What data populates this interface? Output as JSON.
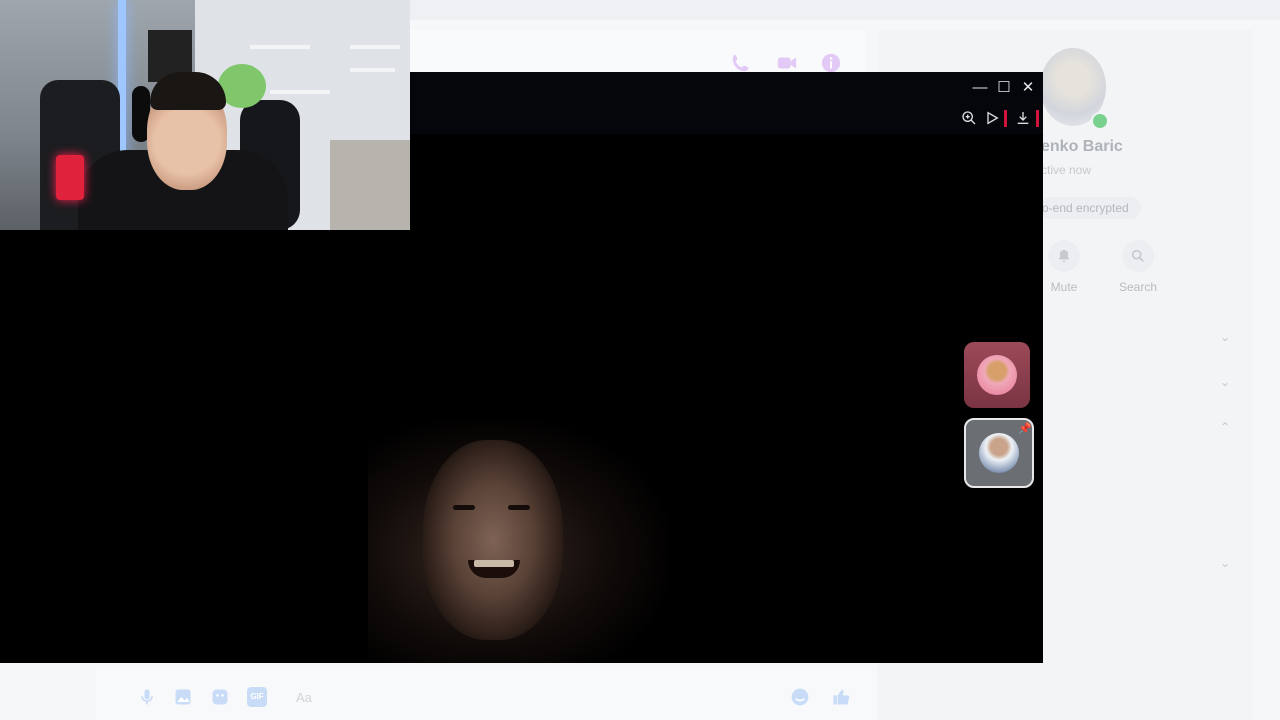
{
  "contact": {
    "name": "enko Baric",
    "status": "ctive now",
    "encryption_badge": "o-end encrypted"
  },
  "actions": [
    {
      "label": "Mute",
      "icon": "bell-icon"
    },
    {
      "label": "Search",
      "icon": "search-icon"
    }
  ],
  "composer": {
    "placeholder": "Aa",
    "gif_label": "GIF"
  },
  "viewer": {
    "minimize_glyph": "—",
    "maximize_glyph": "☐",
    "close_glyph": "✕"
  },
  "colors": {
    "accent": "#c77dff",
    "online": "#7ad18e",
    "viewer_bg": "#000000",
    "record_marker": "#d0143c"
  }
}
